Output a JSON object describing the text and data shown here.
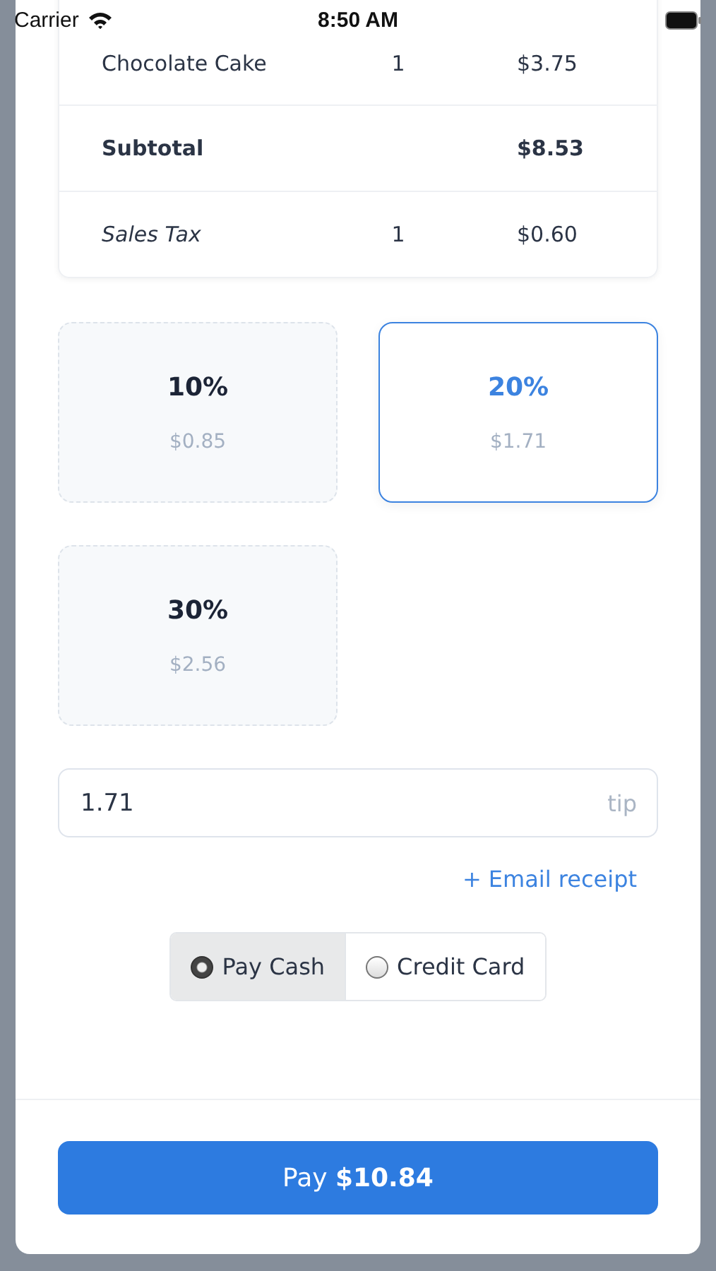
{
  "status_bar": {
    "carrier": "Carrier",
    "time": "8:50 AM"
  },
  "order_items": [
    {
      "kind": "item",
      "name": "Chocolate Cake",
      "quantity": "1",
      "price": "$3.75"
    },
    {
      "kind": "subtotal",
      "name": "Subtotal",
      "price": "$8.53"
    },
    {
      "kind": "tax",
      "name": "Sales Tax",
      "quantity": "1",
      "price": "$0.60"
    }
  ],
  "tip_options": [
    {
      "percent": "10%",
      "amount": "$0.85",
      "selected": false
    },
    {
      "percent": "20%",
      "amount": "$1.71",
      "selected": true
    },
    {
      "percent": "30%",
      "amount": "$2.56",
      "selected": false
    }
  ],
  "tip_field": {
    "value": "1.71",
    "suffix": "tip"
  },
  "email_receipt_link": "+ Email receipt",
  "payment_methods": [
    {
      "label": "Pay Cash",
      "selected": true
    },
    {
      "label": "Credit Card",
      "selected": false
    }
  ],
  "pay_button": "Pay **$10.84**"
}
